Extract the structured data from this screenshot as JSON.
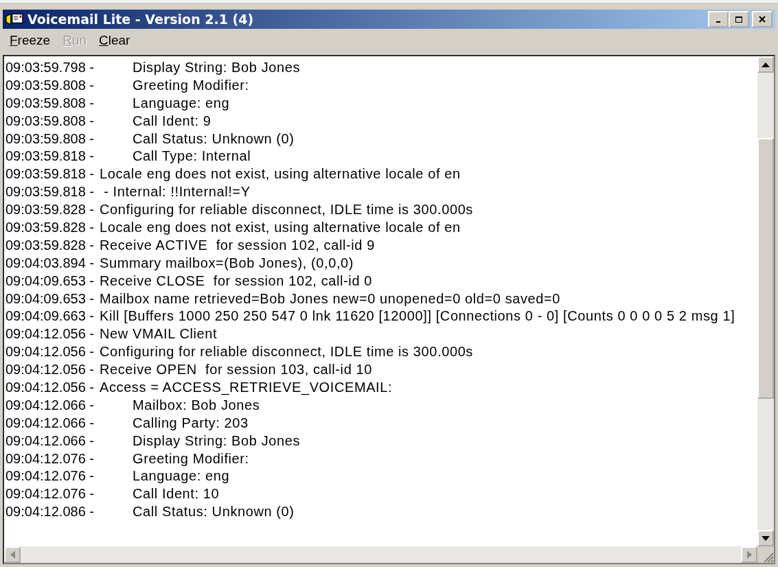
{
  "window": {
    "title": "Voicemail Lite - Version 2.1 (4)"
  },
  "menu": [
    {
      "label": "Freeze",
      "disabled": false
    },
    {
      "label": "Run",
      "disabled": true
    },
    {
      "label": "Clear",
      "disabled": false
    }
  ],
  "log": [
    {
      "time": "09:03:59.798 -",
      "message": "Display String: Bob Jones",
      "indented": true
    },
    {
      "time": "09:03:59.808 -",
      "message": "Greeting Modifier:",
      "indented": true
    },
    {
      "time": "09:03:59.808 -",
      "message": "Language: eng",
      "indented": true
    },
    {
      "time": "09:03:59.808 -",
      "message": "Call Ident: 9",
      "indented": true
    },
    {
      "time": "09:03:59.808 -",
      "message": "Call Status: Unknown (0)",
      "indented": true
    },
    {
      "time": "09:03:59.818 -",
      "message": "Call Type: Internal",
      "indented": true
    },
    {
      "time": "09:03:59.818 -",
      "message": "Locale eng does not exist, using alternative locale of en",
      "indented": false
    },
    {
      "time": "09:03:59.818 -",
      "message": " - Internal: !!Internal!=Y",
      "indented": false
    },
    {
      "time": "09:03:59.828 -",
      "message": "Configuring for reliable disconnect, IDLE time is 300.000s",
      "indented": false
    },
    {
      "time": "09:03:59.828 -",
      "message": "Locale eng does not exist, using alternative locale of en",
      "indented": false
    },
    {
      "time": "09:03:59.828 -",
      "message": "Receive ACTIVE  for session 102, call-id 9",
      "indented": false
    },
    {
      "time": "09:04:03.894 -",
      "message": "Summary mailbox=(Bob Jones), (0,0,0)",
      "indented": false
    },
    {
      "time": "09:04:09.653 -",
      "message": "Receive CLOSE  for session 102, call-id 0",
      "indented": false
    },
    {
      "time": "09:04:09.653 -",
      "message": "Mailbox name retrieved=Bob Jones new=0 unopened=0 old=0 saved=0",
      "indented": false
    },
    {
      "time": "09:04:09.663 -",
      "message": "Kill [Buffers 1000 250 250 547 0 lnk 11620 [12000]] [Connections 0 - 0] [Counts 0 0 0 0 5 2 msg 1]",
      "indented": false
    },
    {
      "time": "09:04:12.056 -",
      "message": "New VMAIL Client",
      "indented": false
    },
    {
      "time": "09:04:12.056 -",
      "message": "Configuring for reliable disconnect, IDLE time is 300.000s",
      "indented": false
    },
    {
      "time": "09:04:12.056 -",
      "message": "Receive OPEN  for session 103, call-id 10",
      "indented": false
    },
    {
      "time": "09:04:12.056 -",
      "message": "Access = ACCESS_RETRIEVE_VOICEMAIL:",
      "indented": false
    },
    {
      "time": "09:04:12.066 -",
      "message": "Mailbox: Bob Jones",
      "indented": true
    },
    {
      "time": "09:04:12.066 -",
      "message": "Calling Party: 203",
      "indented": true
    },
    {
      "time": "09:04:12.066 -",
      "message": "Display String: Bob Jones",
      "indented": true
    },
    {
      "time": "09:04:12.076 -",
      "message": "Greeting Modifier:",
      "indented": true
    },
    {
      "time": "09:04:12.076 -",
      "message": "Language: eng",
      "indented": true
    },
    {
      "time": "09:04:12.076 -",
      "message": "Call Ident: 10",
      "indented": true
    },
    {
      "time": "09:04:12.086 -",
      "message": "Call Status: Unknown (0)",
      "indented": true
    }
  ]
}
